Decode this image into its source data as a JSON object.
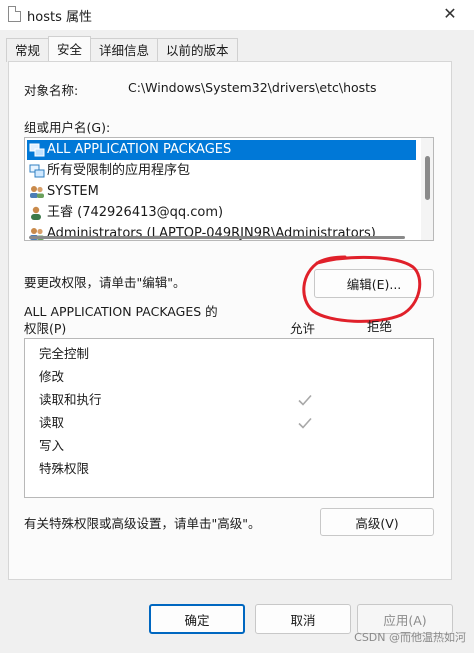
{
  "window": {
    "title": "hosts 属性",
    "close_glyph": "✕"
  },
  "tabs": [
    {
      "label": "常规"
    },
    {
      "label": "安全"
    },
    {
      "label": "详细信息"
    },
    {
      "label": "以前的版本"
    }
  ],
  "object_name": {
    "label": "对象名称:",
    "value": "C:\\Windows\\System32\\drivers\\etc\\hosts"
  },
  "groups": {
    "label": "组或用户名(G):",
    "items": [
      {
        "label": "ALL APPLICATION PACKAGES",
        "icon": "packages-icon"
      },
      {
        "label": "所有受限制的应用程序包",
        "icon": "packages-icon"
      },
      {
        "label": "SYSTEM",
        "icon": "users-group-icon"
      },
      {
        "label": "王睿 (742926413@qq.com)",
        "icon": "user-icon"
      },
      {
        "label": "Administrators (LAPTOP-049RJN9R\\Administrators)",
        "icon": "users-group-icon"
      }
    ]
  },
  "edit": {
    "prompt": "要更改权限，请单击\"编辑\"。",
    "button_label": "编辑(E)..."
  },
  "permissions": {
    "title_line1": "ALL APPLICATION PACKAGES 的",
    "title_line2": "权限(P)",
    "col_allow": "允许",
    "col_deny": "拒绝",
    "rows": [
      {
        "label": "完全控制",
        "allow": false
      },
      {
        "label": "修改",
        "allow": false
      },
      {
        "label": "读取和执行",
        "allow": true
      },
      {
        "label": "读取",
        "allow": true
      },
      {
        "label": "写入",
        "allow": false
      },
      {
        "label": "特殊权限",
        "allow": false
      }
    ]
  },
  "advanced": {
    "prompt": "有关特殊权限或高级设置，请单击\"高级\"。",
    "button_label": "高级(V)"
  },
  "footer": {
    "ok_label": "确定",
    "cancel_label": "取消",
    "apply_label": "应用(A)"
  },
  "watermark": "CSDN @而他温热如河",
  "colors": {
    "selection": "#0078d7",
    "annotation_red": "#e0202a",
    "check_gray": "#a8a8a8"
  }
}
